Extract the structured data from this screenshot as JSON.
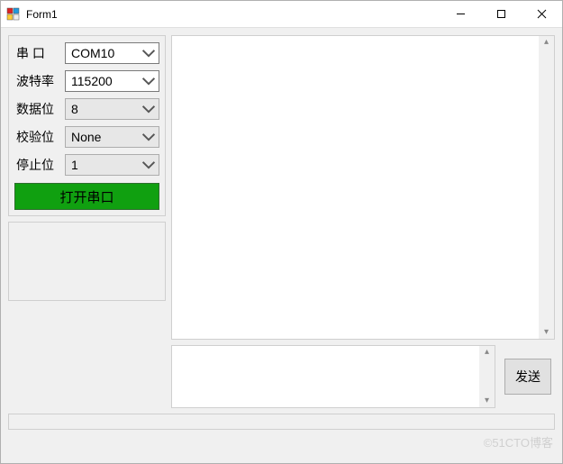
{
  "window": {
    "title": "Form1"
  },
  "config": {
    "port_label": "串  口",
    "port_value": "COM10",
    "baud_label": "波特率",
    "baud_value": "115200",
    "databits_label": "数据位",
    "databits_value": "8",
    "parity_label": "校验位",
    "parity_value": "None",
    "stopbits_label": "停止位",
    "stopbits_value": "1",
    "open_button": "打开串口"
  },
  "send": {
    "button_label": "发送"
  },
  "watermark": "©51CTO博客"
}
